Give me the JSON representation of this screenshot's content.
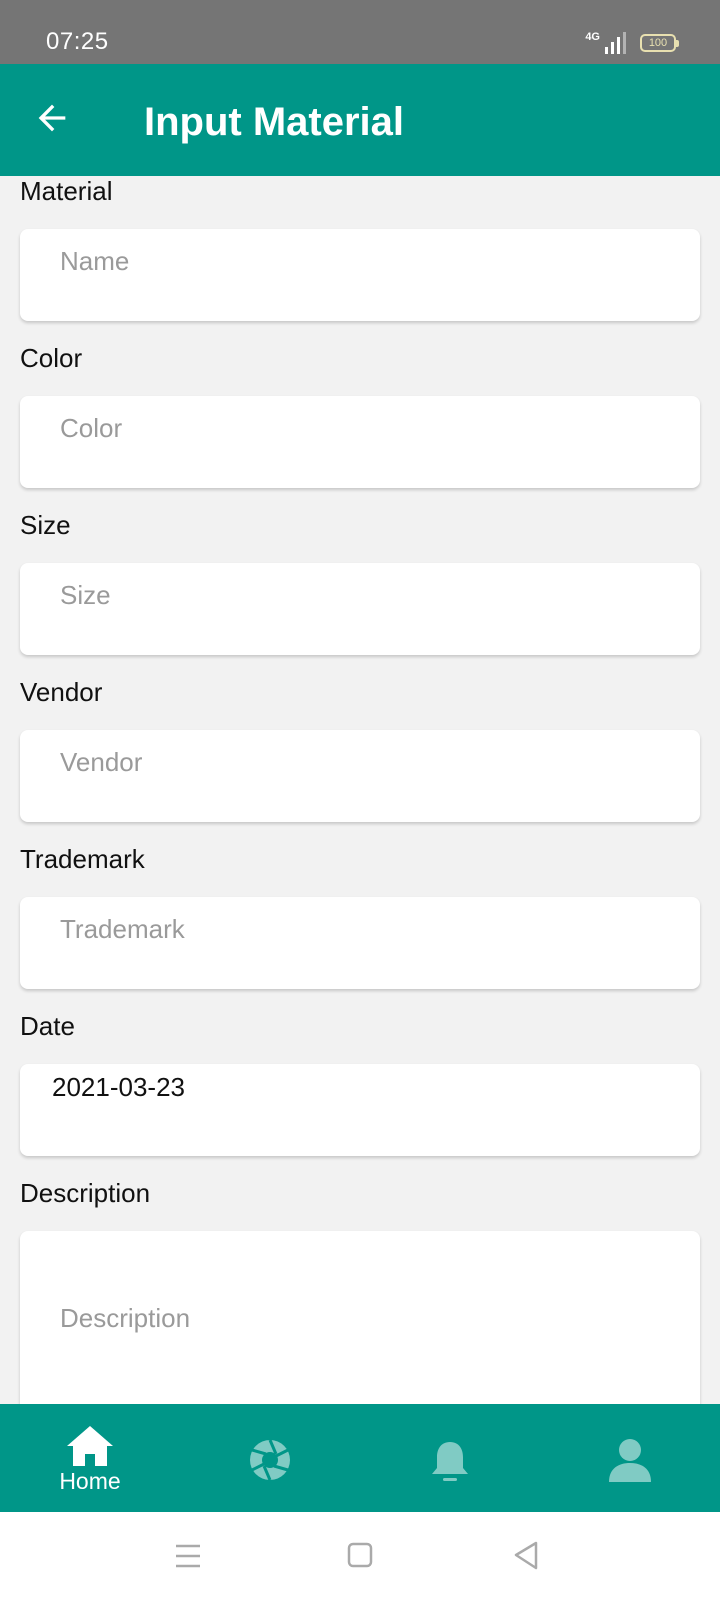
{
  "status_bar": {
    "time": "07:25",
    "network": "4G",
    "battery": "100"
  },
  "app_bar": {
    "title": "Input Material",
    "back_icon": "arrow-left-icon"
  },
  "form": {
    "material": {
      "label": "Material",
      "placeholder": "Name",
      "value": ""
    },
    "color": {
      "label": "Color",
      "placeholder": "Color",
      "value": ""
    },
    "size": {
      "label": "Size",
      "placeholder": "Size",
      "value": ""
    },
    "vendor": {
      "label": "Vendor",
      "placeholder": "Vendor",
      "value": ""
    },
    "trademark": {
      "label": "Trademark",
      "placeholder": "Trademark",
      "value": ""
    },
    "date": {
      "label": "Date",
      "value": "2021-03-23"
    },
    "description": {
      "label": "Description",
      "placeholder": "Description",
      "value": ""
    }
  },
  "bottom_nav": {
    "items": [
      {
        "label": "Home",
        "icon": "home-icon",
        "active": true
      },
      {
        "label": "",
        "icon": "aperture-icon",
        "active": false
      },
      {
        "label": "",
        "icon": "bell-icon",
        "active": false
      },
      {
        "label": "",
        "icon": "person-icon",
        "active": false
      }
    ]
  },
  "system_nav": {
    "icons": [
      "menu-icon",
      "home-square-icon",
      "back-triangle-icon"
    ]
  },
  "colors": {
    "primary": "#009688",
    "status_bar": "#757575",
    "background": "#f2f2f2",
    "inactive_icon": "#80cbc4"
  }
}
